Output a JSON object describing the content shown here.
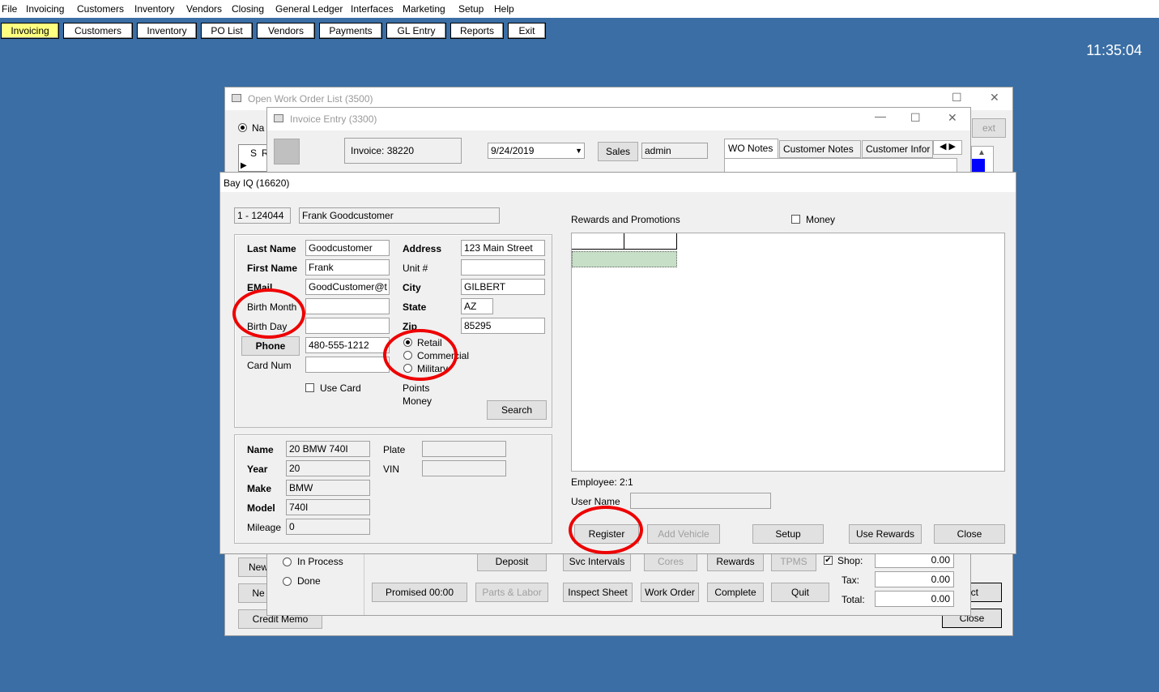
{
  "menu": [
    "File",
    "Invoicing",
    "Customers",
    "Inventory",
    "Vendors",
    "Closing",
    "General Ledger",
    "Interfaces",
    "Marketing",
    "Setup",
    "Help"
  ],
  "toolbar": [
    "Invoicing",
    "Customers",
    "Inventory",
    "PO List",
    "Vendors",
    "Payments",
    "GL Entry",
    "Reports",
    "Exit"
  ],
  "clock": "11:35:04",
  "wo_list": {
    "title": "Open Work Order List (3500)",
    "radio_label": "Na",
    "col_s": "S",
    "col_r": "R",
    "next_label": "ext",
    "new1": "New",
    "new2": "Ne",
    "credit_memo": "Credit Memo",
    "select_label": "ect",
    "close": "Close"
  },
  "invoice": {
    "title": "Invoice Entry (3300)",
    "invoice_label": "Invoice: 38220",
    "date": "9/24/2019",
    "sales_btn": "Sales",
    "sales_user": "admin",
    "tabs": [
      "WO Notes",
      "Customer Notes",
      "Customer Infor"
    ],
    "status_in_process": "In Process",
    "status_done": "Done",
    "promised": "Promised  00:00",
    "buttons_row1": {
      "deposit": "Deposit",
      "svc": "Svc Intervals",
      "cores": "Cores",
      "rewards": "Rewards",
      "tpms": "TPMS"
    },
    "buttons_row2": {
      "parts": "Parts & Labor",
      "inspect": "Inspect Sheet",
      "work_order": "Work Order",
      "complete": "Complete",
      "quit": "Quit"
    },
    "shop_label": "Shop:",
    "tax_label": "Tax:",
    "total_label": "Total:",
    "shop_value": "0.00",
    "tax_value": "0.00",
    "total_value": "0.00"
  },
  "bayiq": {
    "title": "Bay IQ (16620)",
    "account_id": "1 - 124044",
    "account_name": "Frank Goodcustomer",
    "labels": {
      "last_name": "Last Name",
      "first_name": "First Name",
      "email": "EMail",
      "birth_month": "Birth Month",
      "birth_day": "Birth Day",
      "phone": "Phone",
      "card_num": "Card Num",
      "use_card": "Use Card",
      "address": "Address",
      "unit": "Unit #",
      "city": "City",
      "state": "State",
      "zip": "Zip",
      "points": "Points",
      "money": "Money",
      "search": "Search",
      "v_name": "Name",
      "v_year": "Year",
      "v_make": "Make",
      "v_model": "Model",
      "v_mileage": "Mileage",
      "plate": "Plate",
      "vin": "VIN"
    },
    "values": {
      "last_name": "Goodcustomer",
      "first_name": "Frank",
      "email": "GoodCustomer@t",
      "birth_month": "",
      "birth_day": "",
      "phone": "480-555-1212",
      "card_num": "",
      "address": "123 Main Street",
      "unit": "",
      "city": "GILBERT",
      "state": "AZ",
      "zip": "85295",
      "v_name": "20 BMW 740I",
      "v_year": "20",
      "v_make": "BMW",
      "v_model": "740I",
      "v_mileage": "0",
      "plate": "",
      "vin": ""
    },
    "customer_type": {
      "retail": "Retail",
      "commercial": "Commercial",
      "military": "Military",
      "selected": "Retail"
    },
    "rewards_label": "Rewards and Promotions",
    "money_chk": "Money",
    "employee": "Employee: 2:1",
    "user_name_label": "User Name",
    "buttons": {
      "register": "Register",
      "add_vehicle": "Add Vehicle",
      "setup": "Setup",
      "use_rewards": "Use Rewards",
      "close": "Close"
    }
  },
  "colors": {
    "desktop": "#3a6ea5",
    "highlight": "#ffff80",
    "annotation": "#e00000",
    "grid_row": "#c6dfc6"
  }
}
